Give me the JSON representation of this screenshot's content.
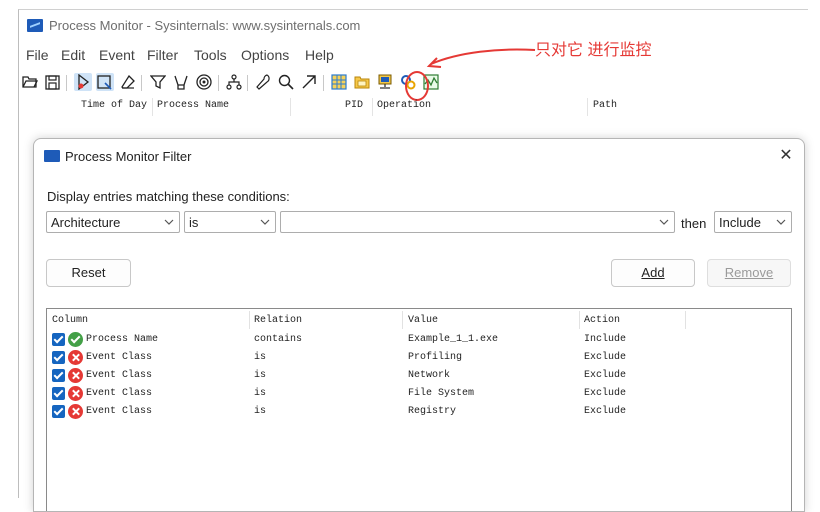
{
  "window": {
    "title": "Process Monitor - Sysinternals: www.sysinternals.com"
  },
  "menu": [
    "File",
    "Edit",
    "Event",
    "Filter",
    "Tools",
    "Options",
    "Help"
  ],
  "toolbar_icons": [
    "open-icon",
    "save-icon",
    "capture-icon",
    "autoscroll-icon",
    "clear-icon",
    "filter-icon",
    "highlight-icon",
    "target-icon",
    "process-tree-icon",
    "find-icon",
    "search-icon",
    "jump-icon",
    "registry-icon",
    "file-system-icon",
    "network-icon",
    "process-activity-icon",
    "profiling-icon"
  ],
  "annotation": {
    "text": "只对它 进行监控",
    "color": "#e53935"
  },
  "columns": {
    "time": "Time of Day",
    "process": "Process Name",
    "pid": "PID",
    "operation": "Operation",
    "path": "Path"
  },
  "dialog": {
    "title": "Process Monitor Filter",
    "instruction": "Display entries matching these conditions:",
    "column_value": "Architecture",
    "relation_value": "is",
    "value_value": "",
    "then_label": "then",
    "action_value": "Include",
    "reset_label": "Reset",
    "add_label": "Add",
    "remove_label": "Remove",
    "list_headers": {
      "column": "Column",
      "relation": "Relation",
      "value": "Value",
      "action": "Action"
    },
    "rows": [
      {
        "column": "Process Name",
        "relation": "contains",
        "value": "Example_1_1.exe",
        "action": "Include",
        "checked": true,
        "status": "include"
      },
      {
        "column": "Event Class",
        "relation": "is",
        "value": "Profiling",
        "action": "Exclude",
        "checked": true,
        "status": "exclude"
      },
      {
        "column": "Event Class",
        "relation": "is",
        "value": "Network",
        "action": "Exclude",
        "checked": true,
        "status": "exclude"
      },
      {
        "column": "Event Class",
        "relation": "is",
        "value": "File System",
        "action": "Exclude",
        "checked": true,
        "status": "exclude"
      },
      {
        "column": "Event Class",
        "relation": "is",
        "value": "Registry",
        "action": "Exclude",
        "checked": true,
        "status": "exclude"
      }
    ]
  },
  "colors": {
    "accent": "#1565c0",
    "include": "#43a047",
    "exclude": "#e53935"
  }
}
